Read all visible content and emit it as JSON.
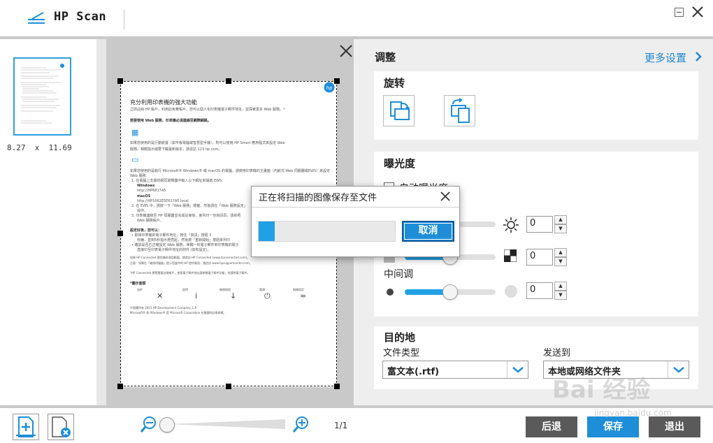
{
  "app": {
    "title": "HP Scan"
  },
  "thumbnail": {
    "size_label": "8.27  x  11.69"
  },
  "document": {
    "lines": [
      "充分利用印表機的強大功能",
      "立即註冊 HP 帳戶，利用此免費帳戶，您可以個人化印表機電子郵件地址，並探索更多 Web 服務。*",
      "若要使用 Web 服務，印表機必須連線至網際網路。",
      "如果您使用的是行動裝置（如平板電腦或智慧型手機），則可以使用 HP Smart 應用程式來設定 Web",
      "服務。相關指示或要下載最新版本，請造訪 123.hp.com。",
      "如果您使用的是執行 Microsoft® Windows® 或 macOS 的電腦，請使用印表機的主畫面（內嵌式 Web 伺服器或EWS）來設定",
      "Web 服務：",
      "1.  在電腦上支援的網頁瀏覽器中輸入以下網址來開啟 EWS：",
      "Windows",
      "http://HP6817A5",
      "macOS",
      "http://HP1062E5E617A5.local.",
      "2.  在 EWS 中，請按一下「Web 服務」標籤，然後請在「Web 服務設定」",
      "操作。",
      "3.  印表機連線至 HP 伺服器並完成註冊後，會列印一份資訊頁，請依照",
      "Web 服務帳戶。",
      "設定好後，您可以：",
      "•  取得印表機的電子郵件地址，按住「資訊」按鈕 3",
      "秒鐘，直到5秒指示燈亮起，然後按「重新開始」按鈕來列印",
      "•  確認是否已正確設定 Web 服務，單獨一封電子郵件到印表機的電子",
      "直接印至印表電子郵件地址的附件 (如有設定)。",
      "如果 HP Connected 使用條款適用範圍，請造訪 HP Connected (www.hpconnected.com)。",
      "注意：如果在「確保伺服器」提示您當中的 HP 提供資訊，請造訪 www.hpsupportcenter.com。",
      "*HP Connected 閱覽需要註冊帳戶，使用電子郵件地址請參閱電子郵件功能，並請附電子郵件。",
      "*圖示面部",
      "由於",
      "說明",
      "無線按鈕",
      "電源",
      "無線設定",
      "©版權所有 2015 HP Development Company, L.P.",
      "Microsoft® 和 Windows® 是 Microsoft Corporation 在美國的註冊商標。"
    ]
  },
  "panel": {
    "adjust_title": "调整",
    "more_settings": "更多设置",
    "rotate": {
      "title": "旋转"
    },
    "exposure": {
      "title": "曝光度",
      "auto_label": "自动曝光度",
      "brightness_value": "0",
      "contrast_value": "0",
      "midtone_label": "中间调",
      "midtone_value": "0",
      "brightness_level": 0.5,
      "contrast_level": 0.5,
      "midtone_level": 0.5
    },
    "destination": {
      "title": "目的地",
      "file_type_label": "文件类型",
      "file_type_value": "富文本(.rtf)",
      "send_to_label": "发送到",
      "send_to_value": "本地或网络文件夹"
    }
  },
  "dialog": {
    "title": "正在将扫描的图像保存至文件",
    "cancel_label": "取消",
    "progress_fraction": 0.12
  },
  "bottom": {
    "page_count": "1/1",
    "zoom_level": 0.0,
    "back_label": "后退",
    "save_label": "保存",
    "exit_label": "退出"
  },
  "watermark": {
    "brand": "Bai 经验",
    "url": "jingyan.baidu.com"
  },
  "colors": {
    "accent": "#21a0e6",
    "button_dark": "#555555",
    "button_blue": "#1e8ed8"
  }
}
